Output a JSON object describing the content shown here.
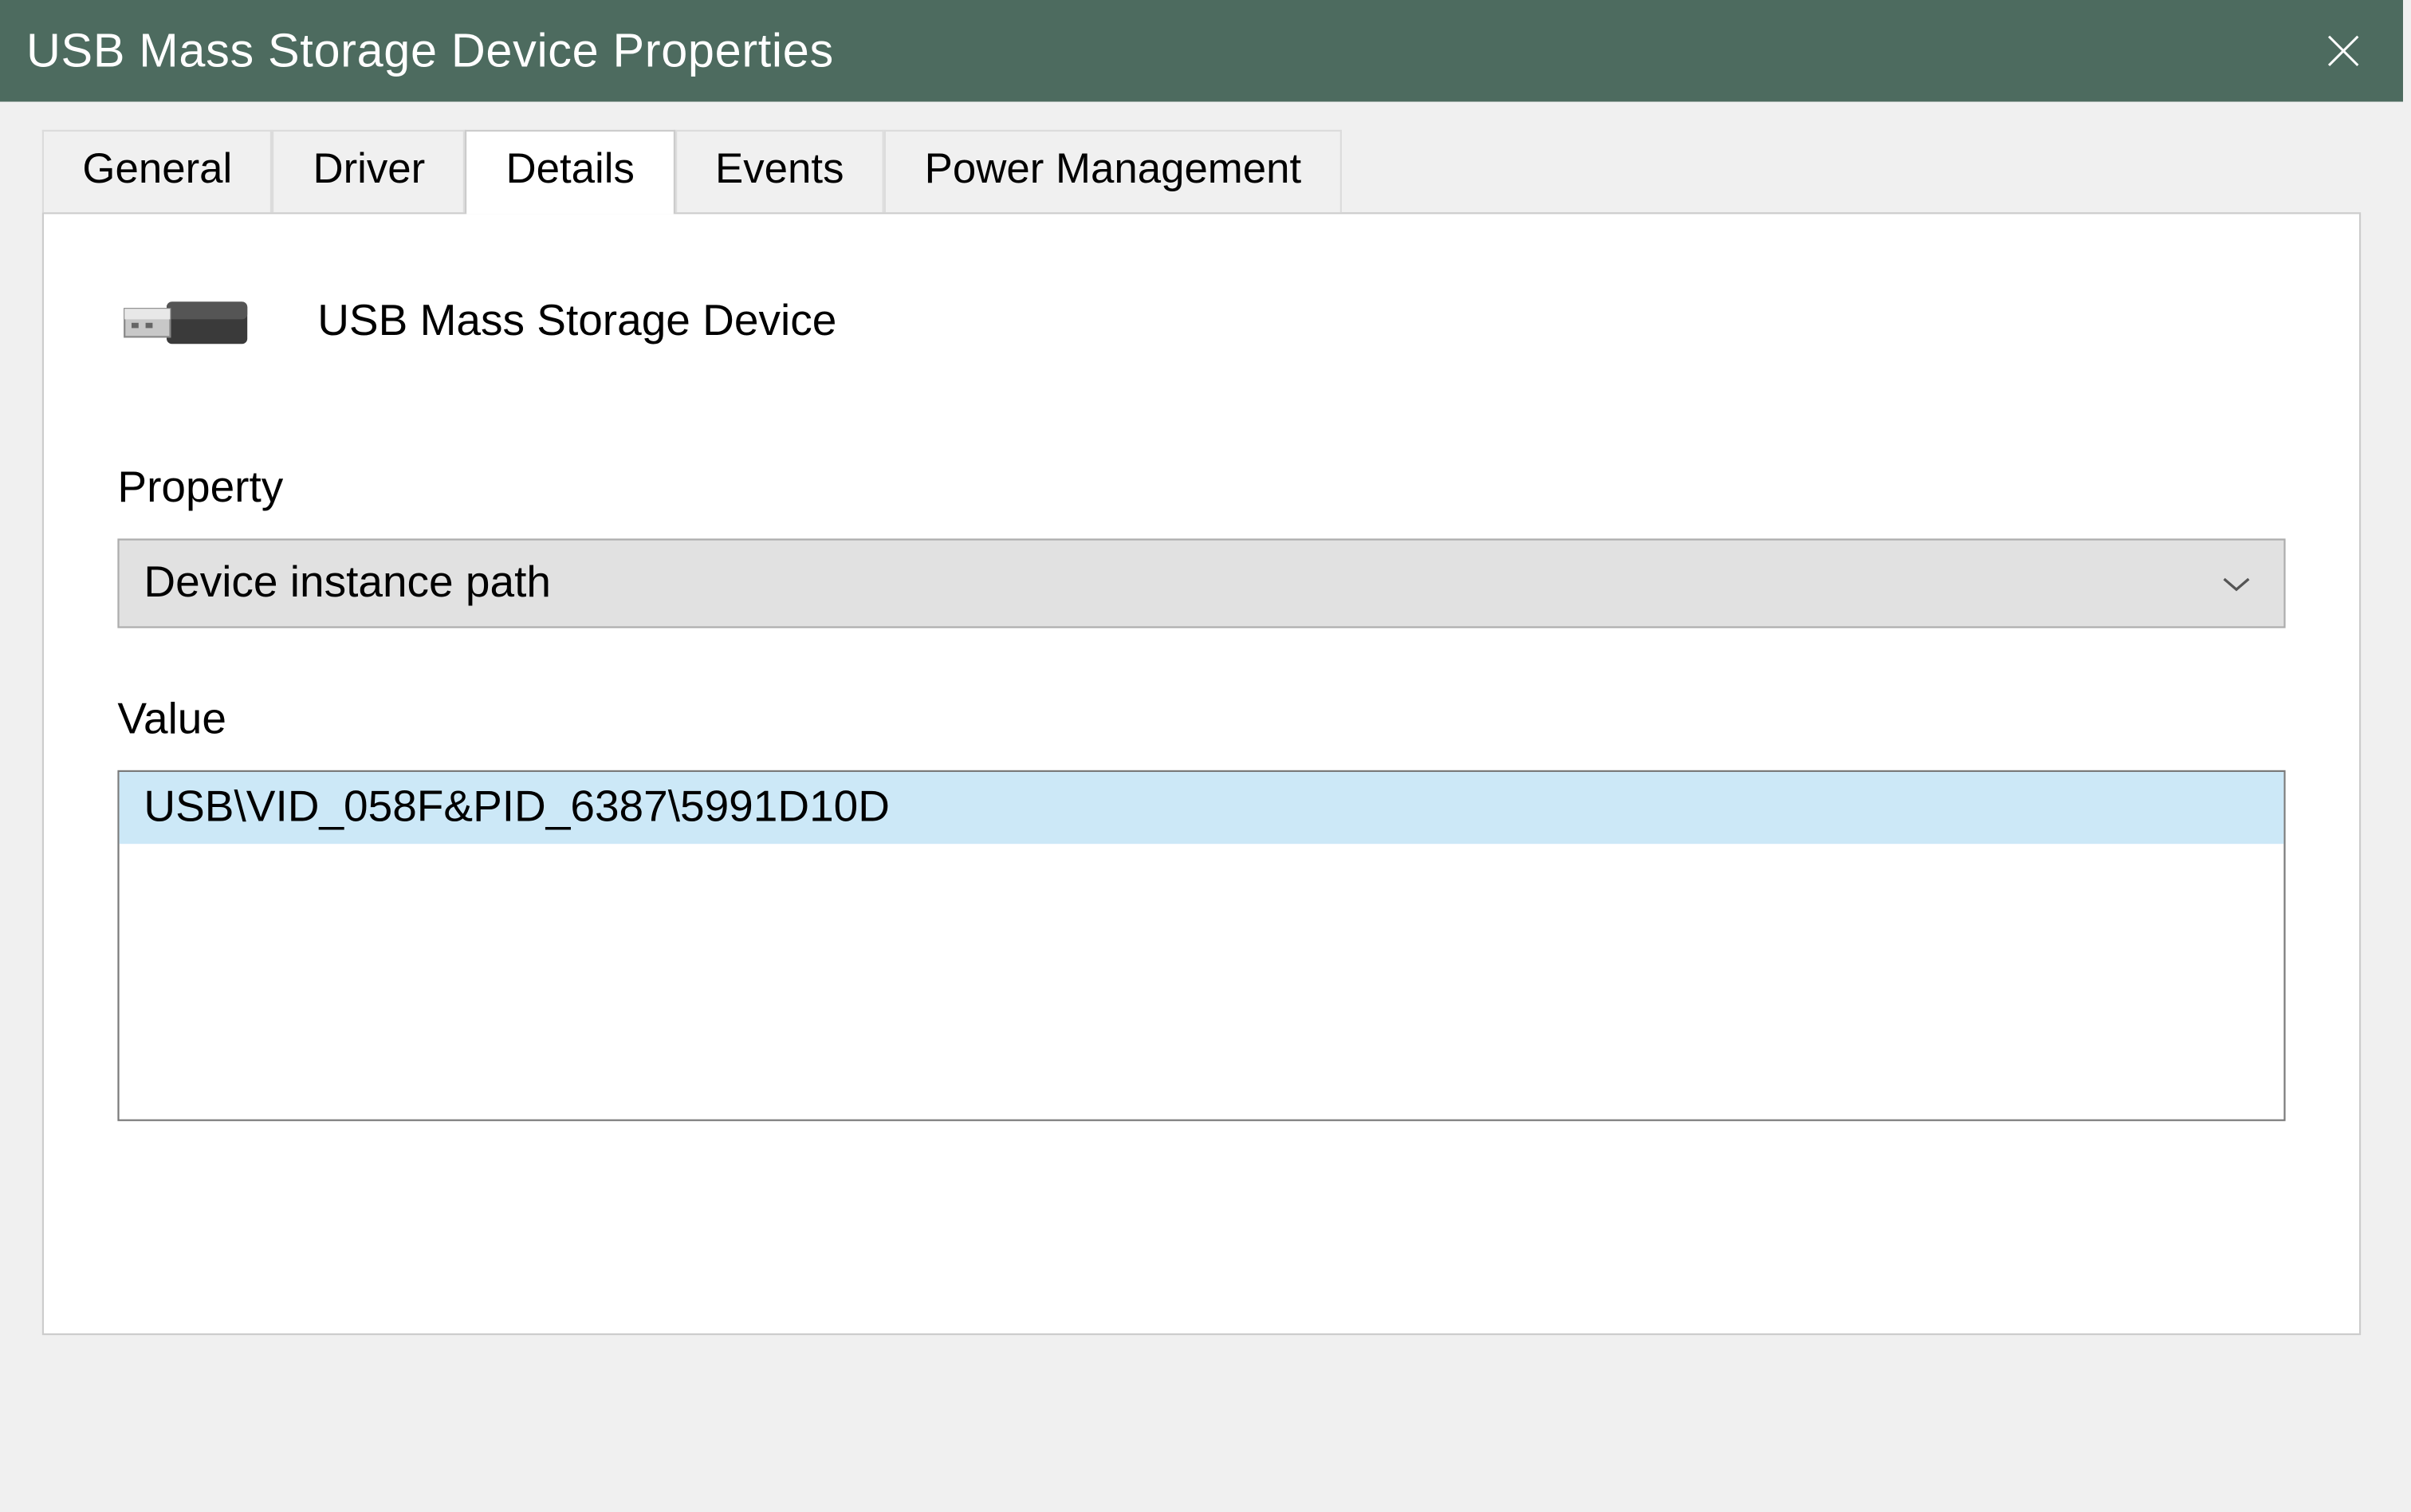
{
  "titlebar": {
    "title": "USB Mass Storage Device Properties"
  },
  "tabs": {
    "items": [
      {
        "label": "General",
        "active": false
      },
      {
        "label": "Driver",
        "active": false
      },
      {
        "label": "Details",
        "active": true
      },
      {
        "label": "Events",
        "active": false
      },
      {
        "label": "Power Management",
        "active": false
      }
    ]
  },
  "details": {
    "device_name": "USB Mass Storage Device",
    "property_label": "Property",
    "property_selected": "Device instance path",
    "value_label": "Value",
    "value_item": "USB\\VID_058F&PID_6387\\5991D10D"
  }
}
